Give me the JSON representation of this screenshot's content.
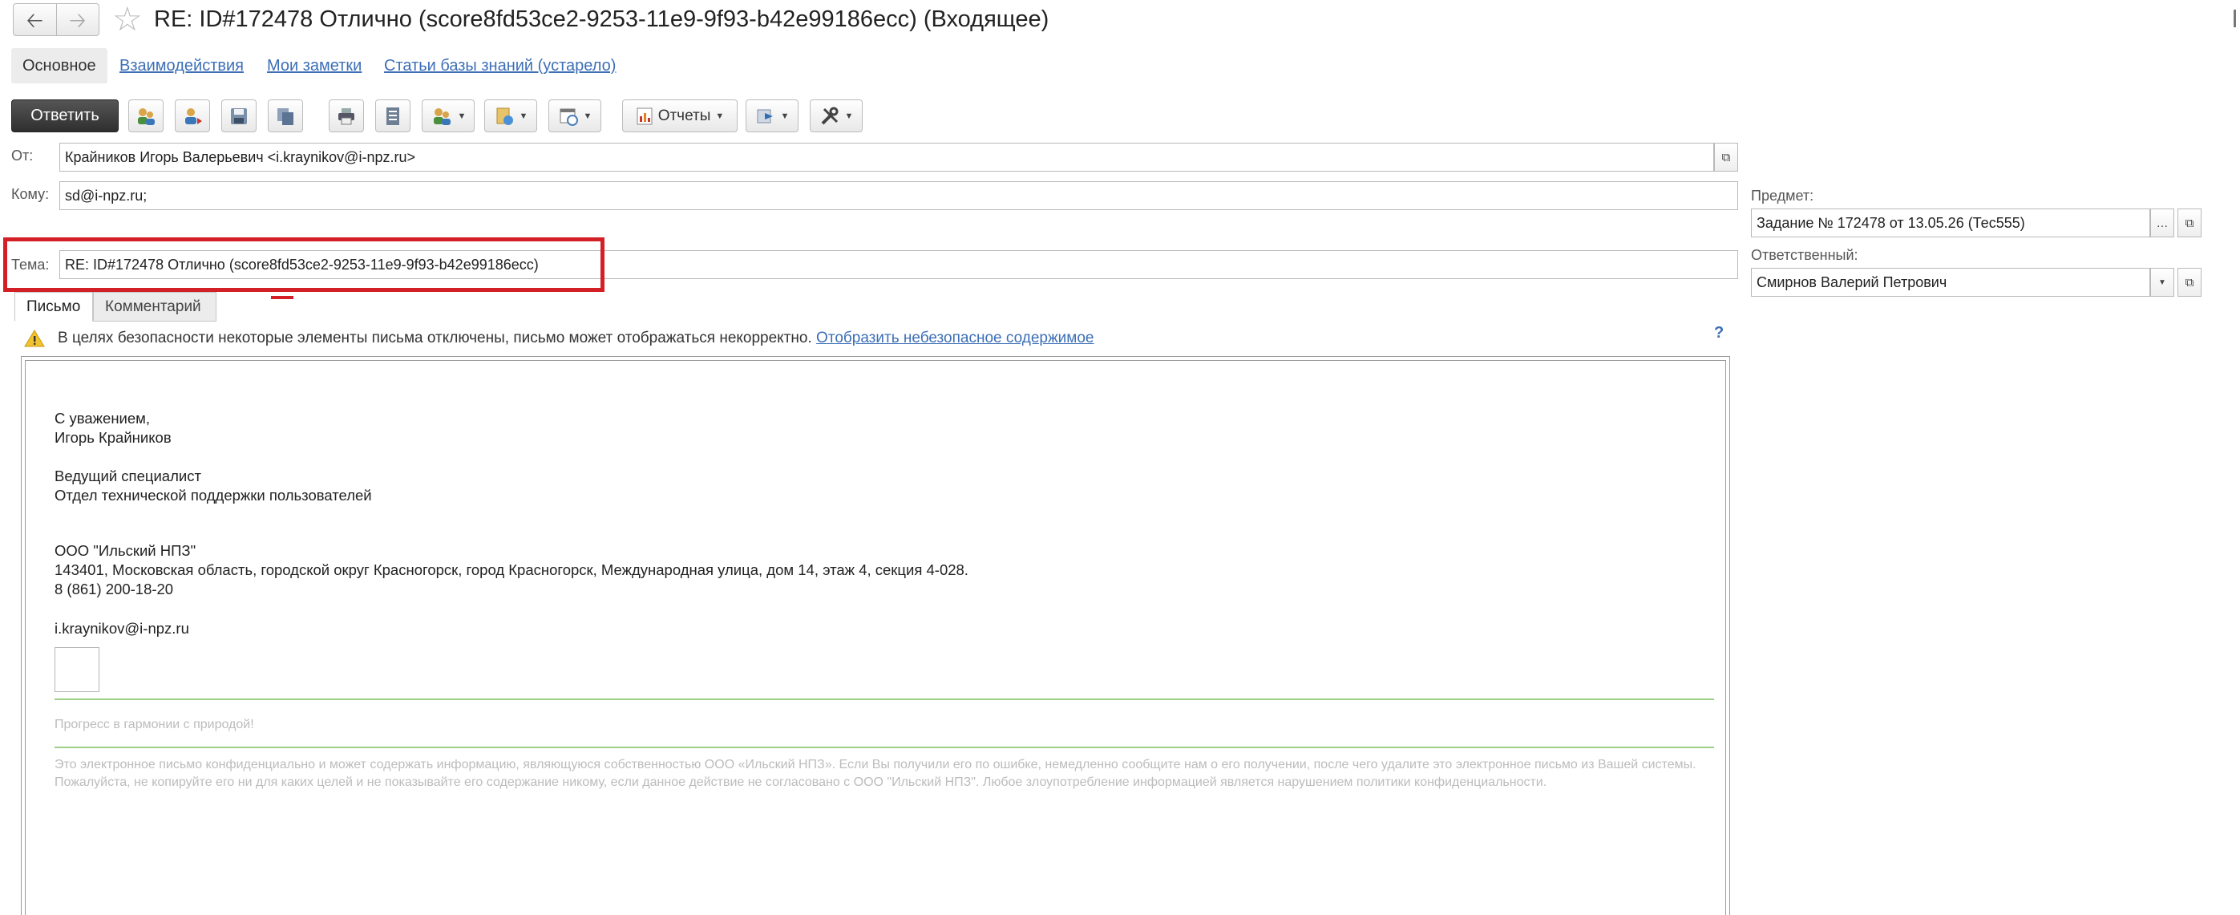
{
  "window": {
    "title": "RE: ID#172478 Отлично (score8fd53ce2-9253-11e9-9f93-b42e99186ecc) (Входящее)"
  },
  "tabs": {
    "main": "Основное",
    "interactions": "Взаимодействия",
    "notes": "Мои заметки",
    "kb": "Статьи базы знаний (устарело)"
  },
  "toolbar": {
    "reply": "Ответить",
    "reports": "Отчеты"
  },
  "fields": {
    "from_label": "От:",
    "from_value": "Крайников Игорь Валерьевич <i.kraynikov@i-npz.ru>",
    "to_label": "Кому:",
    "to_value": "sd@i-npz.ru;",
    "subject_label": "Тема:",
    "subject_value": "RE: ID#172478 Отлично (score8fd53ce2-9253-11e9-9f93-b42e99186ecc)",
    "topic_label": "Предмет:",
    "topic_value": "Задание № 172478 от 13.05.26 (Тес555)",
    "responsible_label": "Ответственный:",
    "responsible_value": "Смирнов Валерий Петрович"
  },
  "letter_tabs": {
    "letter": "Письмо",
    "comment": "Комментарий"
  },
  "warning": {
    "text": "В целях безопасности некоторые элементы письма отключены, письмо может отображаться некорректно.",
    "link": "Отобразить небезопасное содержимое",
    "help": "?"
  },
  "letter": {
    "regards": "С уважением,",
    "name": "Игорь Крайников",
    "position": "Ведущий специалист",
    "department": "Отдел технической поддержки пользователей",
    "company": "ООО \"Ильский НПЗ\"",
    "address": "143401, Московская область, городской округ Красногорск, город Красногорск, Международная улица, дом 14, этаж 4, секция 4-028.",
    "phone": "8 (861) 200-18-20",
    "email": "i.kraynikov@i-npz.ru",
    "slogan": "Прогресс в гармонии с природой!",
    "disclaimer": "Это электронное письмо конфиденциально и может содержать информацию, являющуюся собственностью ООО «Ильский НПЗ». Если Вы получили его по ошибке, немедленно сообщите нам о его получении, после чего удалите это электронное письмо из Вашей системы. Пожалуйста, не копируйте его ни для каких целей и не показывайте его содержание никому, если данное действие не согласовано с ООО \"Ильский НПЗ\". Любое злоупотребление информацией является нарушением политики конфиденциальности."
  },
  "colors": {
    "link": "#3d6fb6",
    "highlight": "#d32027",
    "separator": "#9fcf85"
  }
}
